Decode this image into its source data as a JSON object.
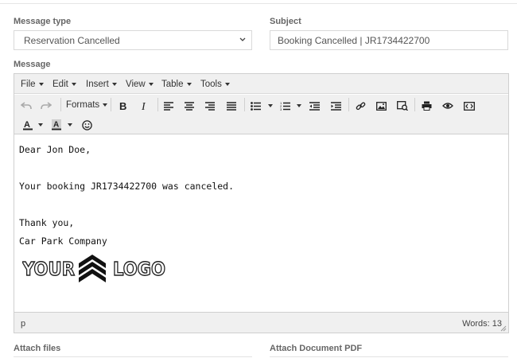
{
  "form": {
    "message_type_label": "Message type",
    "message_type_value": "Reservation Cancelled",
    "subject_label": "Subject",
    "subject_value": "Booking Cancelled | JR1734422700",
    "message_label": "Message",
    "attach_files_label": "Attach files",
    "attach_pdf_label": "Attach Document PDF"
  },
  "editor": {
    "menu": [
      "File",
      "Edit",
      "Insert",
      "View",
      "Table",
      "Tools"
    ],
    "toolbar": {
      "formats_label": "Formats",
      "icons": [
        "undo-icon",
        "redo-icon",
        "bold-icon",
        "italic-icon",
        "align-left-icon",
        "align-center-icon",
        "align-right-icon",
        "align-justify-icon",
        "bullet-list-icon",
        "numbered-list-icon",
        "outdent-icon",
        "indent-icon",
        "link-icon",
        "image-icon",
        "media-icon",
        "print-icon",
        "preview-icon",
        "code-icon",
        "text-color-icon",
        "background-color-icon",
        "emoticons-icon"
      ]
    },
    "content": {
      "greeting": "Dear Jon Doe,",
      "body": "Your booking JR1734422700 was canceled.",
      "thanks": "Thank you,",
      "signature": "Car Park Company"
    },
    "logo": {
      "left_text": "YOUR",
      "right_text": "LOGO"
    },
    "status": {
      "path": "p",
      "word_count": "Words: 13"
    }
  },
  "colors": {
    "border": "#d9d9d9",
    "toolbar_bg": "#f0f0f0",
    "label": "#666666",
    "text": "#111111"
  }
}
